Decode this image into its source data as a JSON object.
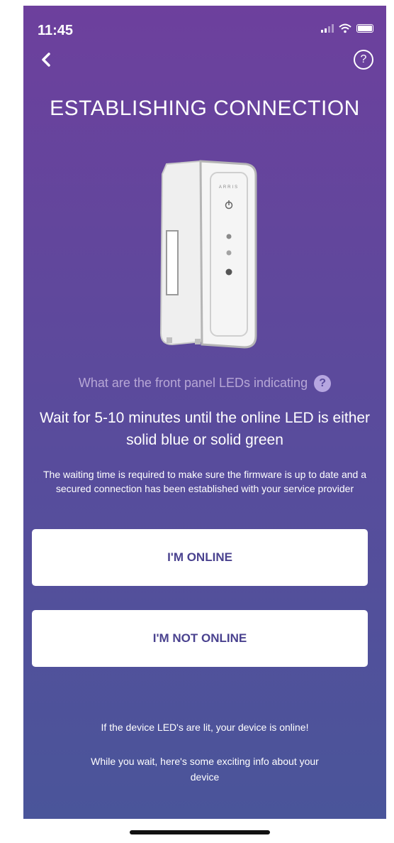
{
  "status_bar": {
    "time": "11:45"
  },
  "header": {
    "back_icon": "chevron-left-icon",
    "help_icon": "question-circle-icon",
    "help_glyph": "?"
  },
  "title": "ESTABLISHING CONNECTION",
  "device": {
    "brand_text": "ARRIS"
  },
  "led_question": {
    "text": "What are the front panel LEDs indicating",
    "icon_glyph": "?"
  },
  "instruction": {
    "main": "Wait for 5-10 minutes until the online LED is either solid blue or solid green",
    "detail": "The waiting time is required to make sure the firmware is up to date and a secured connection has been established with your service provider"
  },
  "buttons": {
    "online": "I'M ONLINE",
    "not_online": "I'M NOT ONLINE"
  },
  "footer": {
    "lit_note": "If the device LED's are lit, your device is online!",
    "wait_info": "While you wait, here's some exciting info about your device"
  },
  "colors": {
    "gradient_top": "#6d409d",
    "gradient_bottom": "#4a559a",
    "button_text": "#4a428f"
  }
}
